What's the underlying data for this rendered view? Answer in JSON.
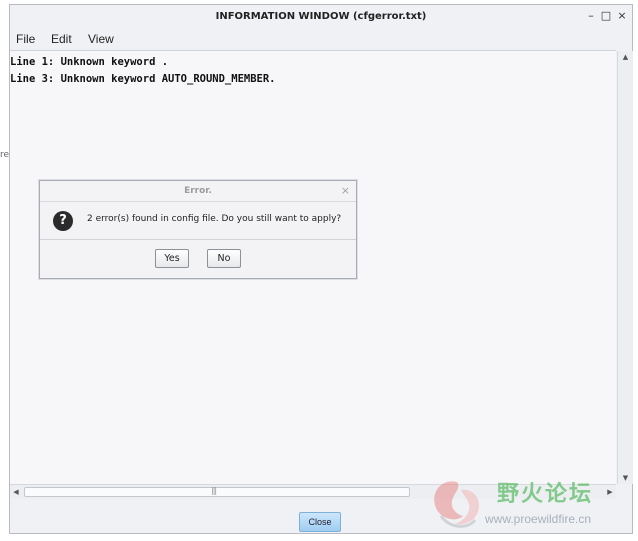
{
  "window": {
    "title": "INFORMATION WINDOW (cfgerror.txt)",
    "controls": {
      "minimize": "–",
      "maximize": "□",
      "close": "×"
    }
  },
  "menubar": {
    "items": [
      "File",
      "Edit",
      "View"
    ]
  },
  "content": {
    "lines": [
      "Line 1: Unknown keyword .",
      "Line 3: Unknown keyword AUTO_ROUND_MEMBER."
    ]
  },
  "scrollbars": {
    "up_arrow": "▲",
    "down_arrow": "▼",
    "left_arrow": "◀",
    "right_arrow": "▶",
    "grip": "|||"
  },
  "footer": {
    "close_label": "Close"
  },
  "dialog": {
    "title": "Error.",
    "close_glyph": "×",
    "icon_glyph": "?",
    "message": "2 error(s) found in config file. Do you still want to apply?",
    "yes_label": "Yes",
    "no_label": "No"
  },
  "background": {
    "edge_text": "re"
  },
  "watermark": {
    "cn_text": "野火论坛",
    "url": "www.proewildfire.cn"
  },
  "colors": {
    "window_bg": "#f0f1f4",
    "content_bg": "#f7f7fa",
    "close_button": "#9fcdf2",
    "watermark_green": "#5fbd6a"
  }
}
